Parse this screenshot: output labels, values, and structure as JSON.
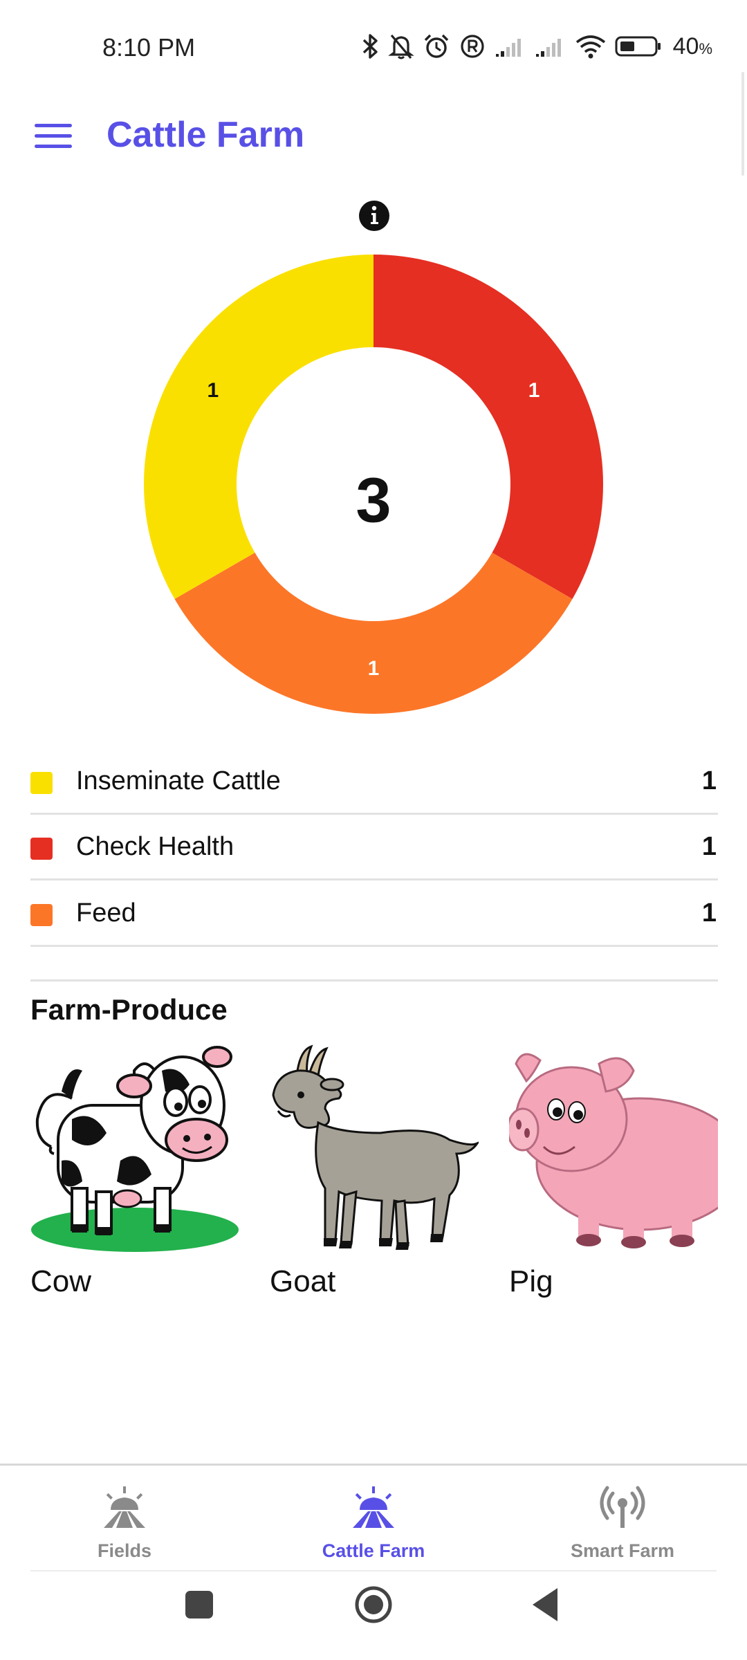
{
  "status_bar": {
    "time": "8:10 PM",
    "battery_percent": "40",
    "battery_suffix": "%"
  },
  "app_bar": {
    "title": "Cattle Farm"
  },
  "chart_data": {
    "type": "pie",
    "variant": "donut",
    "total": "3",
    "categories": [
      "Inseminate Cattle",
      "Check Health",
      "Feed"
    ],
    "values": [
      1,
      1,
      1
    ],
    "value_labels": [
      "1",
      "1",
      "1"
    ],
    "colors": [
      "#fae000",
      "#e52f22",
      "#fc7628"
    ],
    "label_colors": [
      "#111111",
      "#ffffff",
      "#ffffff"
    ]
  },
  "legend": [
    {
      "label": "Inseminate Cattle",
      "value": "1",
      "color": "#fae000"
    },
    {
      "label": "Check Health",
      "value": "1",
      "color": "#e52f22"
    },
    {
      "label": "Feed",
      "value": "1",
      "color": "#fc7628"
    }
  ],
  "produce": {
    "title": "Farm-Produce",
    "items": [
      {
        "name": "Cow"
      },
      {
        "name": "Goat"
      },
      {
        "name": "Pig"
      }
    ]
  },
  "bottom_nav": {
    "items": [
      {
        "label": "Fields",
        "icon": "fields-icon",
        "active": false
      },
      {
        "label": "Cattle Farm",
        "icon": "cattle-farm-icon",
        "active": true
      },
      {
        "label": "Smart Farm",
        "icon": "antenna-icon",
        "active": false
      }
    ],
    "active_color": "#5850e6",
    "inactive_color": "#8a8a8a"
  }
}
